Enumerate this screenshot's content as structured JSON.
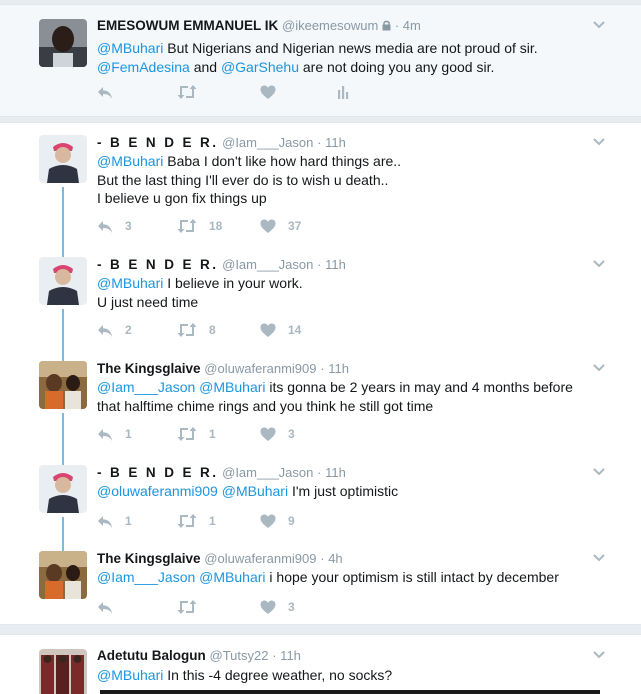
{
  "tweets": [
    {
      "name": "EMESOWUM EMMANUEL IK",
      "handle": "@ikeemesowum",
      "time": "· 4m",
      "line1": {
        "m1": "@MBuhari",
        "t1": " But Nigerians and Nigerian news media are not proud of sir."
      },
      "line2": {
        "m1": "@FemAdesina",
        "t1": "  and ",
        "m2": "@GarShehu",
        "t2": "  are not doing you any good sir."
      },
      "reply_count": "",
      "retweet_count": "",
      "like_count": ""
    },
    {
      "name": "- B E N D E R.",
      "handle": "@Iam___Jason",
      "time": "· 11h",
      "line1": {
        "m1": "@MBuhari",
        "t1": " Baba I don't like how hard things are.."
      },
      "line2": {
        "t1": "But the last thing I'll ever do is to wish u death.."
      },
      "line3": {
        "t1": "I believe u gon fix things up"
      },
      "reply_count": "3",
      "retweet_count": "18",
      "like_count": "37"
    },
    {
      "name": "- B E N D E R.",
      "handle": "@Iam___Jason",
      "time": "· 11h",
      "line1": {
        "m1": "@MBuhari",
        "t1": " I believe in your work."
      },
      "line2": {
        "t1": "U just need time"
      },
      "reply_count": "2",
      "retweet_count": "8",
      "like_count": "14"
    },
    {
      "name": "The Kingsglaive",
      "handle": "@oluwaferanmi909",
      "time": "· 11h",
      "line1": {
        "m1": "@Iam___Jason",
        "t1": " ",
        "m2": "@MBuhari",
        "t2": " its gonna be 2 years in may and 4 months before"
      },
      "line2": {
        "t1": "that halftime chime rings  and you think he still got time"
      },
      "reply_count": "1",
      "retweet_count": "1",
      "like_count": "3"
    },
    {
      "name": "- B E N D E R.",
      "handle": "@Iam___Jason",
      "time": "· 11h",
      "line1": {
        "m1": "@oluwaferanmi909",
        "t1": " ",
        "m2": "@MBuhari",
        "t2": " I'm just optimistic"
      },
      "reply_count": "1",
      "retweet_count": "1",
      "like_count": "9"
    },
    {
      "name": "The Kingsglaive",
      "handle": "@oluwaferanmi909",
      "time": "· 4h",
      "line1": {
        "m1": "@Iam___Jason",
        "t1": " ",
        "m2": "@MBuhari",
        "t2": " i hope your optimism is still intact by december"
      },
      "reply_count": "",
      "retweet_count": "",
      "like_count": "3"
    },
    {
      "name": "Adetutu Balogun",
      "handle": "@Tutsy22",
      "time": "· 11h",
      "line1": {
        "m1": "@MBuhari",
        "t1": "  In this -4 degree weather, no socks?"
      }
    }
  ],
  "icons": {
    "reply": "reply-icon",
    "retweet": "retweet-icon",
    "like": "heart-icon",
    "analytics": "analytics-icon",
    "caret": "chevron-down-icon",
    "lock": "lock-icon"
  },
  "colors": {
    "mention": "#1b95e0",
    "action": "#aab8c2",
    "thread_line": "#7dbbde",
    "background": "#e6ecf0"
  }
}
